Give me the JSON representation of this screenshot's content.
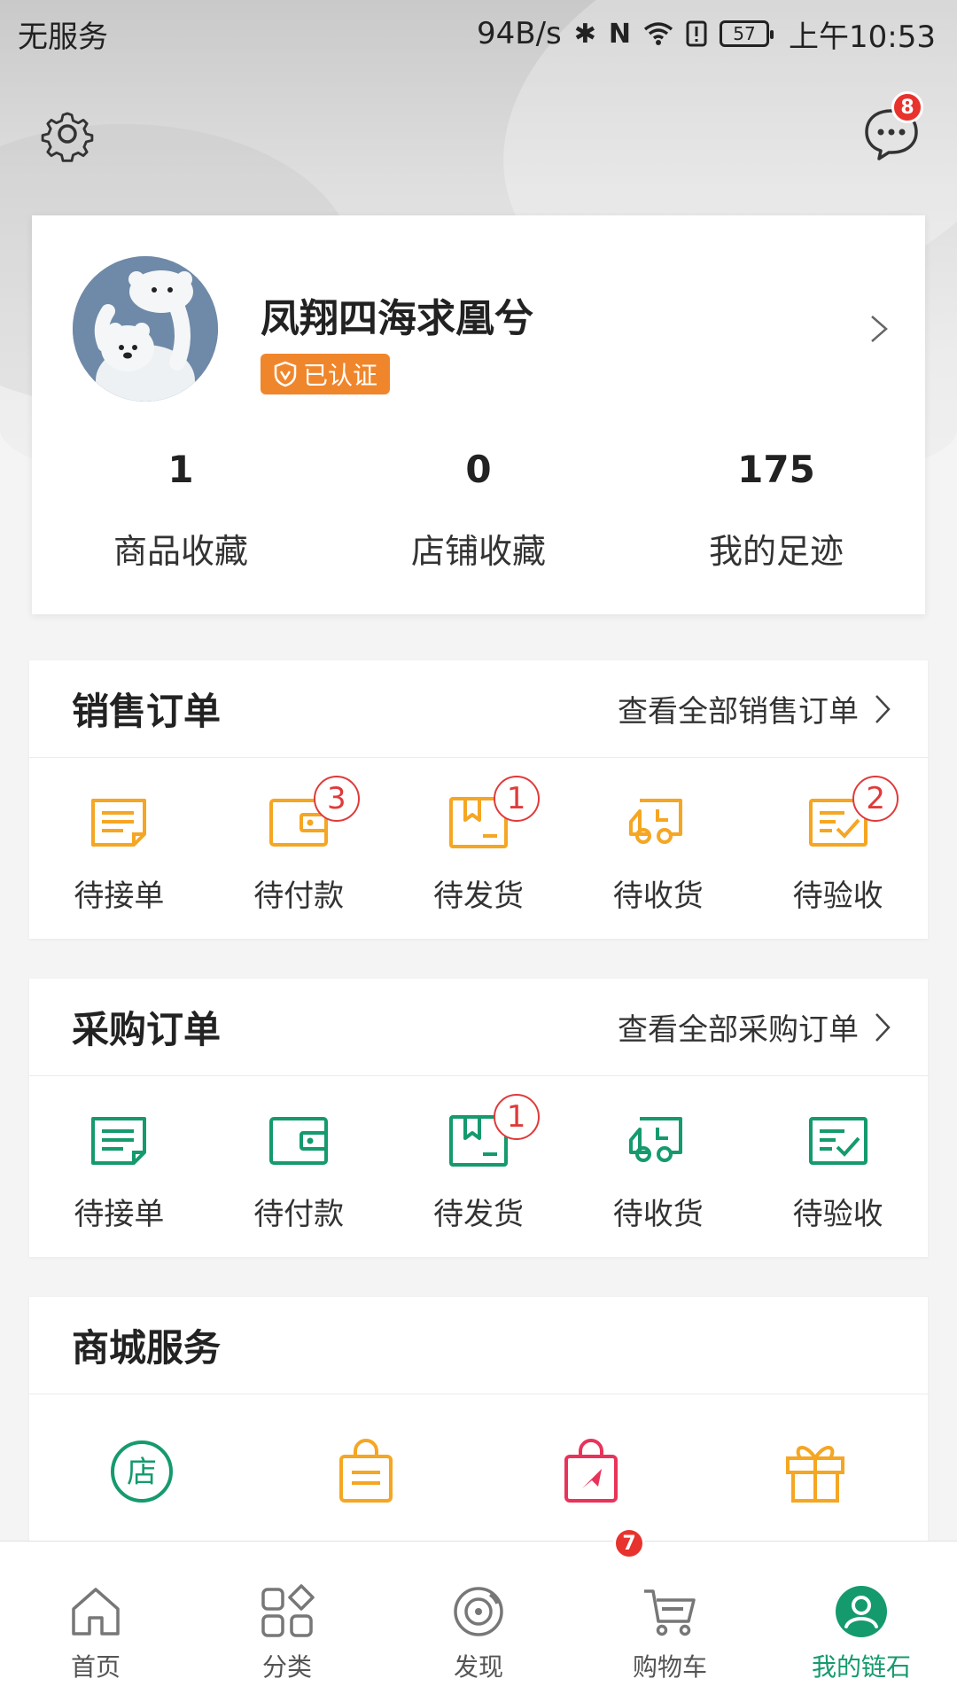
{
  "status_bar": {
    "carrier": "无服务",
    "net_speed": "94B/s",
    "battery": "57",
    "time": "上午10:53"
  },
  "header": {
    "settings_icon": "gear-icon",
    "message_icon": "chat-bubble-icon",
    "message_badge": "8"
  },
  "profile": {
    "name": "凤翔四海求凰兮",
    "verified_label": "已认证",
    "stats": [
      {
        "value": "1",
        "label": "商品收藏"
      },
      {
        "value": "0",
        "label": "店铺收藏"
      },
      {
        "value": "175",
        "label": "我的足迹"
      }
    ]
  },
  "sales_orders": {
    "title": "销售订单",
    "view_all": "查看全部销售订单",
    "accent": "#f5a623",
    "items": [
      {
        "label": "待接单",
        "icon": "document-icon",
        "badge": ""
      },
      {
        "label": "待付款",
        "icon": "wallet-icon",
        "badge": "3"
      },
      {
        "label": "待发货",
        "icon": "package-icon",
        "badge": "1"
      },
      {
        "label": "待收货",
        "icon": "truck-icon",
        "badge": ""
      },
      {
        "label": "待验收",
        "icon": "checklist-icon",
        "badge": "2"
      }
    ]
  },
  "purchase_orders": {
    "title": "采购订单",
    "view_all": "查看全部采购订单",
    "accent": "#159a6e",
    "items": [
      {
        "label": "待接单",
        "icon": "document-icon",
        "badge": ""
      },
      {
        "label": "待付款",
        "icon": "wallet-icon",
        "badge": ""
      },
      {
        "label": "待发货",
        "icon": "package-icon",
        "badge": "1"
      },
      {
        "label": "待收货",
        "icon": "truck-icon",
        "badge": ""
      },
      {
        "label": "待验收",
        "icon": "checklist-icon",
        "badge": ""
      }
    ]
  },
  "mall_services": {
    "title": "商城服务",
    "items": [
      {
        "icon": "store-icon",
        "color": "#159a6e",
        "glyph": "店"
      },
      {
        "icon": "shopping-bag-icon",
        "color": "#f5a623"
      },
      {
        "icon": "promo-bag-icon",
        "color": "#e8335a"
      },
      {
        "icon": "gift-icon",
        "color": "#f5a623"
      }
    ]
  },
  "bottom_nav": {
    "active_color": "#159a6e",
    "items": [
      {
        "label": "首页",
        "icon": "home-icon"
      },
      {
        "label": "分类",
        "icon": "category-icon"
      },
      {
        "label": "发现",
        "icon": "discover-icon"
      },
      {
        "label": "购物车",
        "icon": "cart-icon",
        "badge": "7"
      },
      {
        "label": "我的链石",
        "icon": "profile-icon",
        "active": true
      }
    ]
  }
}
